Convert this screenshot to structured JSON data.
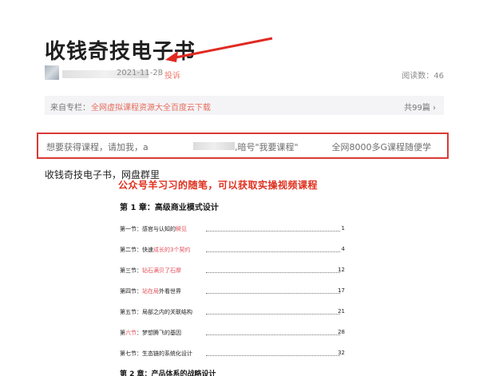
{
  "article": {
    "title": "收钱奇技电子书",
    "date": "2021-11-28",
    "separator": "|",
    "report": "投诉",
    "reads_label": "阅读数：46"
  },
  "topic": {
    "from_label": "来自专栏：",
    "link": "全网虚拟课程资源大全百度云下载",
    "count": "共99篇 ›"
  },
  "notice": {
    "left": "想要获得课程，请加我，a",
    "code": ",暗号\"我要课程\"",
    "right": "全网8000多G课程随便学"
  },
  "body": {
    "line": "收钱奇技电子书，网盘群里",
    "overlay": "公众号羊习习的随笔，可以获取实操视频课程"
  },
  "toc": {
    "chapter": "第 1 章：高级商业模式设计",
    "sections": [
      {
        "prefix": "第一节：感官与认知的",
        "highlight": "瞬见",
        "page": "1"
      },
      {
        "prefix": "第二节：快速",
        "highlight": "成长的3个契约",
        "page": "4"
      },
      {
        "prefix": "第三节：",
        "highlight": "钻石满贝了石摩",
        "page": "12"
      },
      {
        "prefix": "第四节：",
        "highlight": "站在局",
        "suffix": "外看世界",
        "page": "17"
      },
      {
        "prefix": "第五节：局部之内的关联结构",
        "highlight": "",
        "page": "21"
      },
      {
        "prefix": "第",
        "highlight": "六节",
        "suffix": "：梦想腾飞的基因",
        "page": "28"
      },
      {
        "prefix": "第七节：生态链的系统化设计",
        "highlight": "",
        "page": "32"
      }
    ],
    "next_chapter": "第 2 章：产品体系的战略设计"
  },
  "colors": {
    "accent_red": "#d93a35",
    "link_red": "#e56c5d",
    "overlay_red": "#e0301e"
  }
}
